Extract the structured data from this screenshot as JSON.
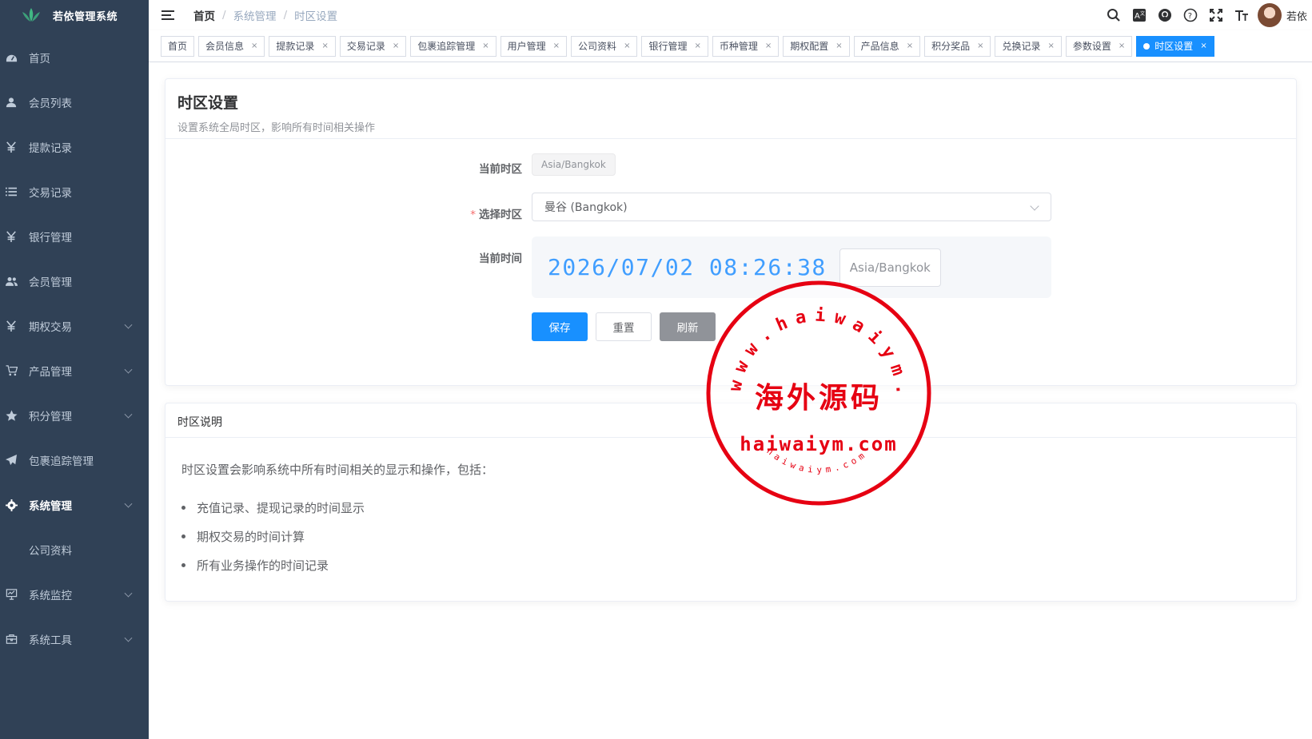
{
  "app": {
    "title": "若依管理系统"
  },
  "sidebar": {
    "items": [
      {
        "label": "首页",
        "icon": "dashboard-icon",
        "expandable": false
      },
      {
        "label": "会员列表",
        "icon": "user-icon",
        "expandable": false
      },
      {
        "label": "提款记录",
        "icon": "yen-icon",
        "expandable": false
      },
      {
        "label": "交易记录",
        "icon": "list-icon",
        "expandable": false
      },
      {
        "label": "银行管理",
        "icon": "yen-icon",
        "expandable": false
      },
      {
        "label": "会员管理",
        "icon": "people-icon",
        "expandable": false
      },
      {
        "label": "期权交易",
        "icon": "yen-icon",
        "expandable": true
      },
      {
        "label": "产品管理",
        "icon": "cart-icon",
        "expandable": true
      },
      {
        "label": "积分管理",
        "icon": "star-icon",
        "expandable": true
      },
      {
        "label": "包裹追踪管理",
        "icon": "send-icon",
        "expandable": false
      },
      {
        "label": "系统管理",
        "icon": "gear-icon",
        "expandable": true,
        "open": true
      },
      {
        "label": "公司资料",
        "icon": "",
        "expandable": false,
        "sub": true
      },
      {
        "label": "系统监控",
        "icon": "monitor-icon",
        "expandable": true
      },
      {
        "label": "系统工具",
        "icon": "toolbox-icon",
        "expandable": true
      }
    ]
  },
  "navbar": {
    "breadcrumb": [
      "首页",
      "系统管理",
      "时区设置"
    ],
    "user_name": "若依"
  },
  "tags": [
    {
      "label": "首页",
      "closable": false
    },
    {
      "label": "会员信息",
      "closable": true
    },
    {
      "label": "提款记录",
      "closable": true
    },
    {
      "label": "交易记录",
      "closable": true
    },
    {
      "label": "包裹追踪管理",
      "closable": true
    },
    {
      "label": "用户管理",
      "closable": true
    },
    {
      "label": "公司资料",
      "closable": true
    },
    {
      "label": "银行管理",
      "closable": true
    },
    {
      "label": "币种管理",
      "closable": true
    },
    {
      "label": "期权配置",
      "closable": true
    },
    {
      "label": "产品信息",
      "closable": true
    },
    {
      "label": "积分奖品",
      "closable": true
    },
    {
      "label": "兑换记录",
      "closable": true
    },
    {
      "label": "参数设置",
      "closable": true
    },
    {
      "label": "时区设置",
      "closable": true,
      "active": true
    }
  ],
  "settings": {
    "title": "时区设置",
    "subtitle": "设置系统全局时区，影响所有时间相关操作",
    "current_label": "当前时区",
    "current_value": "Asia/Bangkok",
    "select_label": "选择时区",
    "select_value": "曼谷 (Bangkok)",
    "time_label": "当前时间",
    "time_value": "2026/07/02 08:26:38",
    "time_tz": "Asia/Bangkok",
    "save_label": "保存",
    "reset_label": "重置",
    "refresh_label": "刷新"
  },
  "explain": {
    "title": "时区说明",
    "intro": "时区设置会影响系统中所有时间相关的显示和操作，包括：",
    "items": [
      "充值记录、提现记录的时间显示",
      "期权交易的时间计算",
      "所有业务操作的时间记录"
    ]
  },
  "watermark": {
    "arc_text": "www.haiwaiym.com",
    "center_text": "海外源码",
    "domain_text": "haiwaiym.com",
    "bottom_arc_text": "haiwaiym.com"
  },
  "colors": {
    "sidebar": "#304156",
    "primary": "#1890ff",
    "stamp": "#e60012"
  }
}
